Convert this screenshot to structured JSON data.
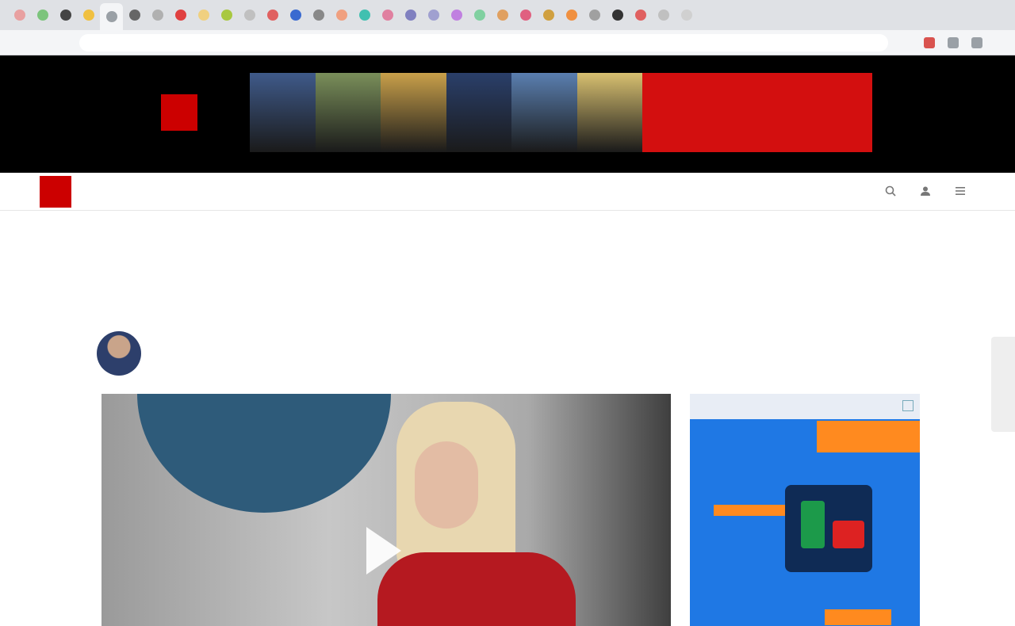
{
  "browser": {
    "tab_favicon_colors": [
      "#e8a0a0",
      "#7cc47c",
      "#444444",
      "#f0c040",
      "#9aa0a6",
      "#666666",
      "#b0b0b0",
      "#e04040",
      "#f0d080",
      "#a8c840",
      "#c0c0c0",
      "#e06060",
      "#3a6ad0",
      "#888888",
      "#f0a080",
      "#40c0b0",
      "#e080a0",
      "#8080c0",
      "#a0a0d0",
      "#c080e0",
      "#80d0a0",
      "#e0a060",
      "#e06080",
      "#d0a040",
      "#f09040",
      "#a0a0a0",
      "#333333",
      "#e06060",
      "#c0c0c0",
      "#d0d0d0"
    ],
    "active_tab_index": 4,
    "url": ""
  },
  "banner_ad": {
    "brand": "",
    "brand_sub": "",
    "cta_text": "",
    "photo_colors": [
      "#3f5a8a",
      "#7a8f5a",
      "#c9a04a",
      "#2a3f6a",
      "#5a7fb0",
      "#d8c070"
    ],
    "cta_color": "#d30f0f"
  },
  "site_nav": {
    "logo": "",
    "items": [
      "",
      "",
      "",
      "",
      "",
      ""
    ],
    "edition": "",
    "icons": [
      "search-icon",
      "user-icon",
      "menu-icon"
    ]
  },
  "section": {
    "line1": "",
    "line2": "",
    "line3": ""
  },
  "article": {
    "headline": "",
    "byline_line1_prefix": "",
    "author": "",
    "byline_line1_suffix": "",
    "byline_line2": ""
  },
  "video": {
    "has_play_button": true
  },
  "side_ad": {
    "label": "",
    "close_glyph": "",
    "title": "",
    "background_color": "#1f78e4",
    "accent_color": "#ff8a1f"
  }
}
